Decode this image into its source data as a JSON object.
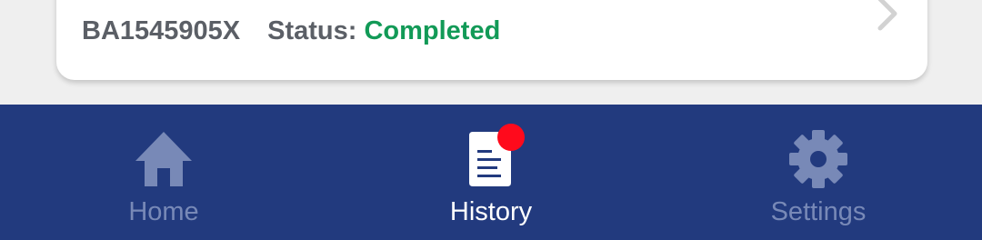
{
  "card": {
    "id": "BA1545905X",
    "status_label": "Status:",
    "status_value": "Completed",
    "status_color": "#129a57",
    "chevron_icon": "chevron-right-icon"
  },
  "nav": {
    "background": "#223a7e",
    "items": [
      {
        "label": "Home",
        "icon": "home-icon",
        "active": false
      },
      {
        "label": "History",
        "icon": "document-icon",
        "active": true,
        "has_badge": true
      },
      {
        "label": "Settings",
        "icon": "gear-icon",
        "active": false
      }
    ]
  }
}
